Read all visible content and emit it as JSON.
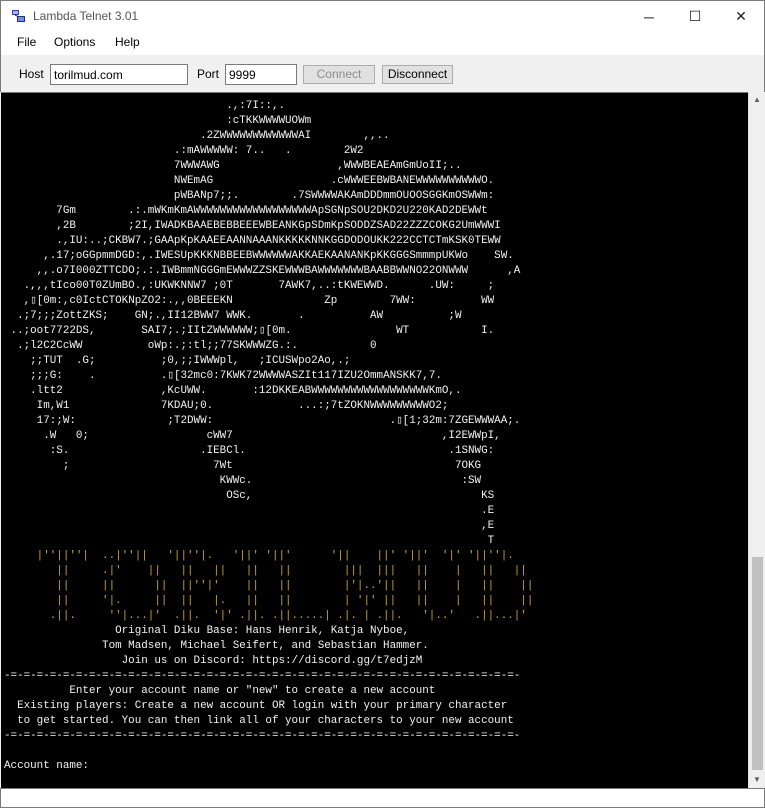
{
  "window": {
    "title": "Lambda Telnet 3.01",
    "icon": "lambda-telnet-app-icon",
    "controls": {
      "minimize": "─",
      "maximize": "☐",
      "close": "✕"
    }
  },
  "menu": {
    "file": "File",
    "options": "Options",
    "help": "Help"
  },
  "toolbar": {
    "host_label": "Host",
    "host_value": "torilmud.com",
    "port_label": "Port",
    "port_value": "9999",
    "connect_label": "Connect",
    "disconnect_label": "Disconnect"
  },
  "terminal": {
    "art": "                                  -\n                                  .,:7I::,.\n                                  :cTKKWWWWUOWm\n                              .2ZWWWWWWWWWWWWAI        ,,..\n                          .:mAWWWWW: 7..   .        2W2\n                          7WWWAWG                  ,WWWBEAEAmGmUoII;..\n                          NWEmAG                  .cWWWEEBWBANEWWWWWWWWWWO.\n                          pWBANp7;;.        .7SWWWWAKAmDDDmmOUOOSGGKmOSWWm:\n        7Gm        .:.mWKmKmAWWWWWWWWWWWWWWWWWWApSGNpSOU2DKD2U220KAD2DEWWt\n        ,2B        ;2I,IWADKBAAEBEBBEEEWBEANKGpSDmKpSODDZSAD22ZZZCOKG2UmWWWI\n        .,IU:..;CKBW7.;GAApKpKAAEEAANNAAANKKKKKNNKGGDODOUKK222CCTCTmKSK0TEWW\n      ,.17;oGGpmmDGD:,.IWESUpKKKNBBEEBWWWWWWAKKAEKAANANKpKKGGGSmmmpUKWo    SW.\n     ,,.o7I000ZTTCDO;.:.IWBmmNGGGmEWWWZZSKEWWWBAWWWWWWWBAABBWWNO22ONWWW      ,A\n   .,,,tIco00T0ZUmBO.,:UKWKNNW7 ;0T       7AWK7,..:tKWEWWD.      .UW:     ;\n   ,▯[0m:,c0IctCTOKNpZO2:.,,0BEEEKN              Zp        7WW:          WW\n  .;7;;;ZottZKS;    GN;.,II12BWW7 WWK.       .          AW          ;W\n ..;oot7722DS,       SAI7;.;IItZWWWWWW;▯[0m.                WT           I.\n  .;l2C2CcWW          oWp:.;:tl;;77SKWWWZG.:.           0\n    ;;TUT  .G;          ;0,;;IWWWpl,   ;ICUSWpo2Ao,.;\n    ;;;G:    .          .▯[32mc0:7KWK72WWWWASZIt117IZU2OmmANSKK7,7.\n    .ltt2               ,KcUWW.       :12DKKEABWWWWWWWWWWWWWWWWWWKmO,.\n     Im,W1              7KDAU;0.             ...:;7tZOKNWWWWWWWWWO2;\n     17:;W:              ;T2DWW:                           .▯[1;32m:7ZGEWWWAA;.\n      .W   0;                  cWW7                                ,I2EWWpI,\n       :S.                    .IEBCl.                               .1SNWG:\n         ;                      7Wt                                  7OKG\n                                 KWWc.                                :SW\n                                  OSc,                                   KS\n                                                                         .E\n                                                                         ,E\n                                                                          T",
    "logo": "     |''||''|  ..|''||   '||''|.   '||' '||'      '||    ||' '||'  '|' '||''|.\n        ||     .|'    ||   ||   ||   ||   ||        |||  |||   ||    |   ||   ||\n        ||     ||      ||  ||''|'    ||   ||        |'|..'||   ||    |   ||    ||\n        ||     '|.     ||  ||   |.   ||   ||        | '|' ||   ||    |   ||    ||\n       .||.     ''|...|'  .||.  '|' .||. .||.....| .|. | .||.   '|..'   .||...|'",
    "credits": "\n                 Original Diku Base: Hans Henrik, Katja Nyboe,\n               Tom Madsen, Michael Seifert, and Sebastian Hammer.\n                  Join us on Discord: https://discord.gg/t7edjzM\n-=-=-=-=-=-=-=-=-=-=-=-=-=-=-=-=-=-=-=-=-=-=-=-=-=-=-=-=-=-=-=-=-=-=-=-=-=-=-=-\n          Enter your account name or \"new\" to create a new account\n  Existing players: Create a new account OR login with your primary character\n  to get started. You can then link all of your characters to your new account\n-=-=-=-=-=-=-=-=-=-=-=-=-=-=-=-=-=-=-=-=-=-=-=-=-=-=-=-=-=-=-=-=-=-=-=-=-=-=-=-\n\nAccount name:"
  },
  "colors": {
    "terminal_bg": "#000000",
    "terminal_fg": "#f2f2f2",
    "logo": "#c8a13a"
  },
  "input": {
    "value": ""
  }
}
